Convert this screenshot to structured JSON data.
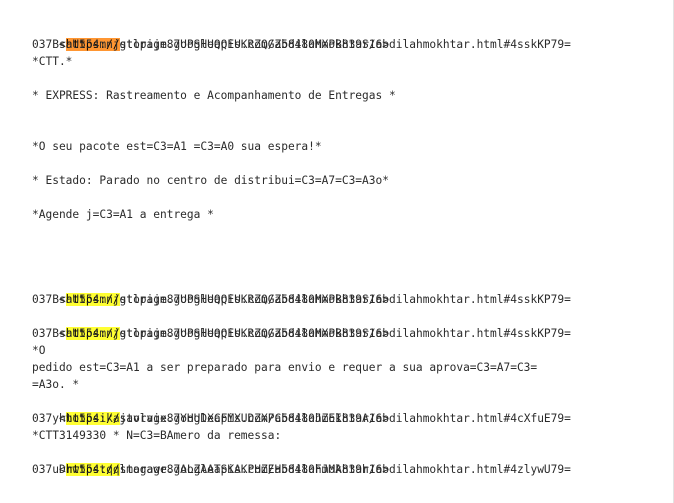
{
  "colors": {
    "highlight": "#ffff33",
    "current_highlight": "#ff9632",
    "text": "#2b2b2b"
  },
  "lines": [
    {
      "pre": "<",
      "hl": "https://",
      "post": "storage.googleapis.com/abdilahmokhtar/abdilahmokhtar.html#4sskKP79="
    },
    {
      "text": "037BsaU554mnjgtlpijm87UPSHUQQEUKRZQGZ58480MXPB839S16>"
    },
    {
      "text": "*CTT.*"
    },
    {
      "text": "* EXPRESS: Rastreamento e Acompanhamento de Entregas *"
    },
    {
      "text": "*O seu pacote est=C3=A1 =C3=A0 sua espera!*"
    },
    {
      "text": "* Estado: Parado no centro de distribui=C3=A7=C3=A3o*"
    },
    {
      "text": "*Agende j=C3=A1 a entrega *"
    },
    {
      "pre": "<",
      "hl": "https://",
      "post": "storage.googleapis.com/abdilahmokhtar/abdilahmokhtar.html#4sskKP79="
    },
    {
      "text": "037BsaU554mnjgtlpijm87UPSHUQQEUKRZQGZ58480MXPB839S16>"
    },
    {
      "pre": "<",
      "hl": "https://",
      "post": "storage.googleapis.com/abdilahmokhtar/abdilahmokhtar.html#4sskKP79="
    },
    {
      "text": "037BsaU554mnjgtlpijm87UPSHUQQEUKRZQGZ58480MXPB839S16>"
    },
    {
      "text": "*O"
    },
    {
      "text": "pedido est=C3=A1 a ser preparado para envio e requer a sua aprova=C3=A7=C3="
    },
    {
      "text": "=A3o. *"
    },
    {
      "pre": "<",
      "hl": "https://",
      "post": "storage.googleapis.com/abdilahmokhtar/abdilahmokhtar.html#4cXfuE79="
    },
    {
      "text": "037yhto554ikajavlvix87YHUDXCFMXUDZXPC58480JZEI839A16>"
    },
    {
      "text": "*CTT3149330 * N=C3=BAmero da remessa:"
    },
    {
      "pre": "<",
      "hl": "https://",
      "post": "storage.googleapis.com/abdilahmokhtar/abdilahmokhtar.html#4zlywU79="
    },
    {
      "text": "037uDrw554tqqlmagawr87ALZAATSKAKPHZEH58480FJMA839h16>"
    }
  ]
}
